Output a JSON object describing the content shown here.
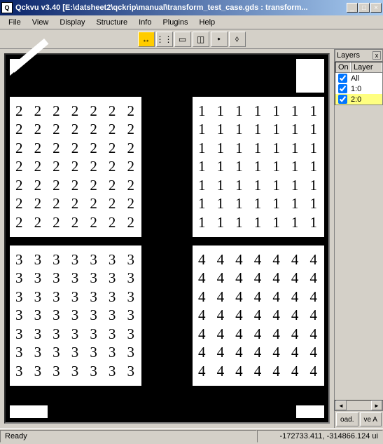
{
  "title": "Qckvu v3.40 [E:\\datsheet2\\qckrip\\manual\\transform_test_case.gds : transform...",
  "menu": [
    "File",
    "View",
    "Display",
    "Structure",
    "Info",
    "Plugins",
    "Help"
  ],
  "tools": {
    "ruler": "↔",
    "t1": "⋮⋮",
    "t2": "▭",
    "t3": "◫",
    "t4": "⬩",
    "t5": "⬨"
  },
  "layers_panel": {
    "title": "Layers",
    "close": "x",
    "cols": {
      "on": "On",
      "layer": "Layer"
    },
    "rows": [
      {
        "on": true,
        "label": "All",
        "selected": false
      },
      {
        "on": true,
        "label": "1:0",
        "selected": false
      },
      {
        "on": true,
        "label": "2:0",
        "selected": true
      }
    ],
    "btn1": "oad.",
    "btn2": "ve A"
  },
  "quads": {
    "q1": {
      "digit": "1",
      "cols": 7,
      "rows": 7
    },
    "q2": {
      "digit": "2",
      "cols": 7,
      "rows": 7
    },
    "q3": {
      "digit": "3",
      "cols": 7,
      "rows": 7
    },
    "q4": {
      "digit": "4",
      "cols": 7,
      "rows": 7
    }
  },
  "status": {
    "left": "Ready",
    "right": "-172733.411, -314866.124 ui"
  },
  "winbtns": {
    "min": "_",
    "max": "□",
    "close": "×"
  },
  "scroll": {
    "left": "◄",
    "right": "►"
  }
}
